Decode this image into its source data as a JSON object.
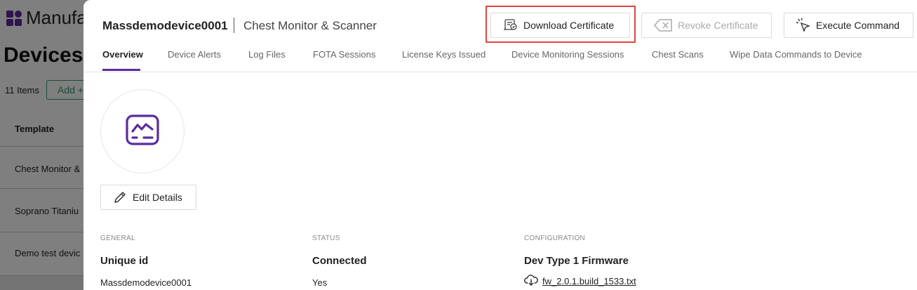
{
  "background": {
    "app_name": "Manufa",
    "page_title": "Devices",
    "item_count": "11 Items",
    "add_button": "Add +",
    "column_header": "Template",
    "rows": [
      "Chest Monitor &",
      "Soprano Titaniu",
      "Demo test devic"
    ]
  },
  "header": {
    "device_name": "Massdemodevice0001",
    "device_template": "Chest Monitor & Scanner"
  },
  "actions": {
    "download_certificate": "Download Certificate",
    "revoke_certificate": "Revoke Certificate",
    "execute_command": "Execute Command"
  },
  "tabs": [
    {
      "label": "Overview",
      "active": true
    },
    {
      "label": "Device Alerts",
      "active": false
    },
    {
      "label": "Log Files",
      "active": false
    },
    {
      "label": "FOTA Sessions",
      "active": false
    },
    {
      "label": "License Keys Issued",
      "active": false
    },
    {
      "label": "Device Monitoring Sessions",
      "active": false
    },
    {
      "label": "Chest Scans",
      "active": false
    },
    {
      "label": "Wipe Data Commands to Device",
      "active": false
    }
  ],
  "edit_details": "Edit Details",
  "sections": {
    "general": {
      "heading": "GENERAL",
      "label": "Unique id",
      "value": "Massdemodevice0001"
    },
    "status": {
      "heading": "STATUS",
      "label": "Connected",
      "value": "Yes"
    },
    "configuration": {
      "heading": "CONFIGURATION",
      "label": "Dev Type 1 Firmware",
      "file": "fw_2.0.1.build_1533.txt"
    }
  },
  "colors": {
    "accent": "#5b2b9e",
    "highlight": "#e0443e",
    "add_button": "#2e9e6a"
  },
  "icons": {
    "download_certificate": "certificate-icon",
    "revoke_certificate": "backspace-x-icon",
    "execute_command": "cursor-click-icon",
    "device": "monitor-waveform-icon",
    "edit": "pencil-icon",
    "firmware": "cloud-download-icon"
  }
}
